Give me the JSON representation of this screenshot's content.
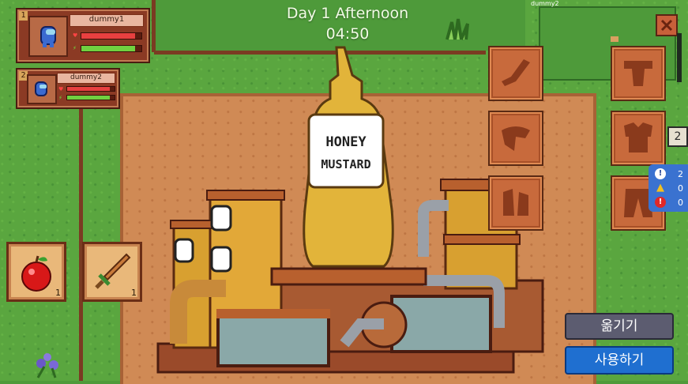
{
  "hud": {
    "day_label": "Day 1 Afternoon",
    "clock": "04:50",
    "minimap_player": "dummy2"
  },
  "players": [
    {
      "index": "1",
      "name": "dummy1",
      "health": 0.9,
      "stamina": 0.9
    },
    {
      "index": "2",
      "name": "dummy2",
      "health": 0.9,
      "stamina": 0.9
    }
  ],
  "machine": {
    "bottle_label_line1": "HONEY",
    "bottle_label_line2": "MUSTARD"
  },
  "equipment": {
    "slots_left": [
      "leg-slot-icon",
      "organ-slot-icon",
      "lungs-slot-icon"
    ],
    "slots_right": [
      "head-slot-icon",
      "body-slot-icon",
      "pants-slot-icon"
    ],
    "equip_count": "2"
  },
  "inventory": [
    {
      "item": "apple",
      "count": "1"
    },
    {
      "item": "sword",
      "count": "1"
    }
  ],
  "status": [
    {
      "type": "info",
      "value": "2"
    },
    {
      "type": "warning",
      "value": "0"
    },
    {
      "type": "error",
      "value": "0"
    }
  ],
  "buttons": {
    "move": "옮기기",
    "use": "사용하기"
  },
  "colors": {
    "grass": "#5aa63f",
    "dirt": "#d08a55",
    "mustard": "#e2b43a",
    "move_button": "#5a5a6e",
    "use_button": "#1f6fd0"
  }
}
